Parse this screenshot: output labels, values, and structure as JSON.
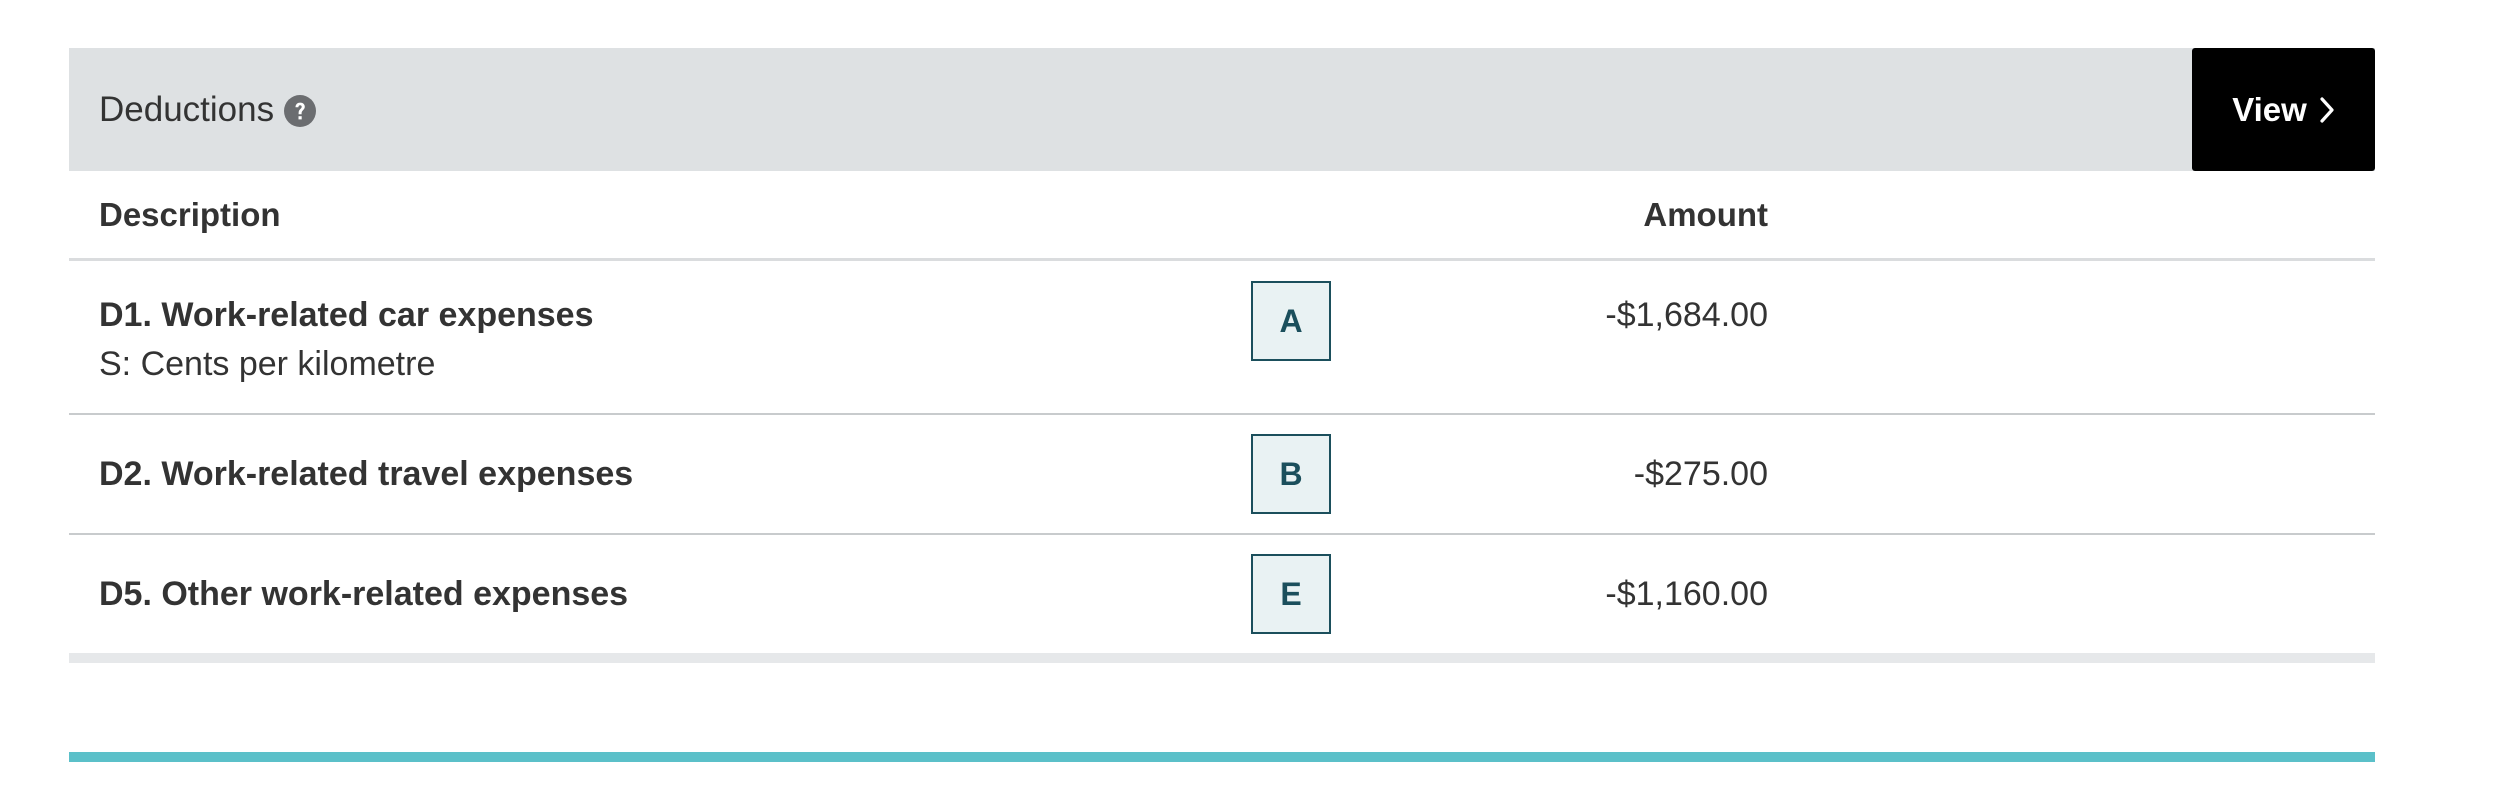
{
  "panel": {
    "title": "Deductions",
    "help_icon": "question-circle-icon",
    "view_button_label": "View",
    "view_button_icon": "chevron-right-icon"
  },
  "columns": {
    "description": "Description",
    "amount": "Amount"
  },
  "rows": [
    {
      "title": "D1. Work-related car expenses",
      "subtitle": "S: Cents per kilometre",
      "code": "A",
      "amount": "-$1,684.00"
    },
    {
      "title": "D2. Work-related travel expenses",
      "code": "B",
      "amount": "-$275.00"
    },
    {
      "title": "D5. Other work-related expenses",
      "code": "E",
      "amount": "-$1,160.00"
    }
  ],
  "colors": {
    "header_bg": "#dee1e3",
    "button_bg": "#000000",
    "code_border": "#1b4f5c",
    "code_bg": "#e9f2f3",
    "accent_bar": "#5bc0c9"
  }
}
